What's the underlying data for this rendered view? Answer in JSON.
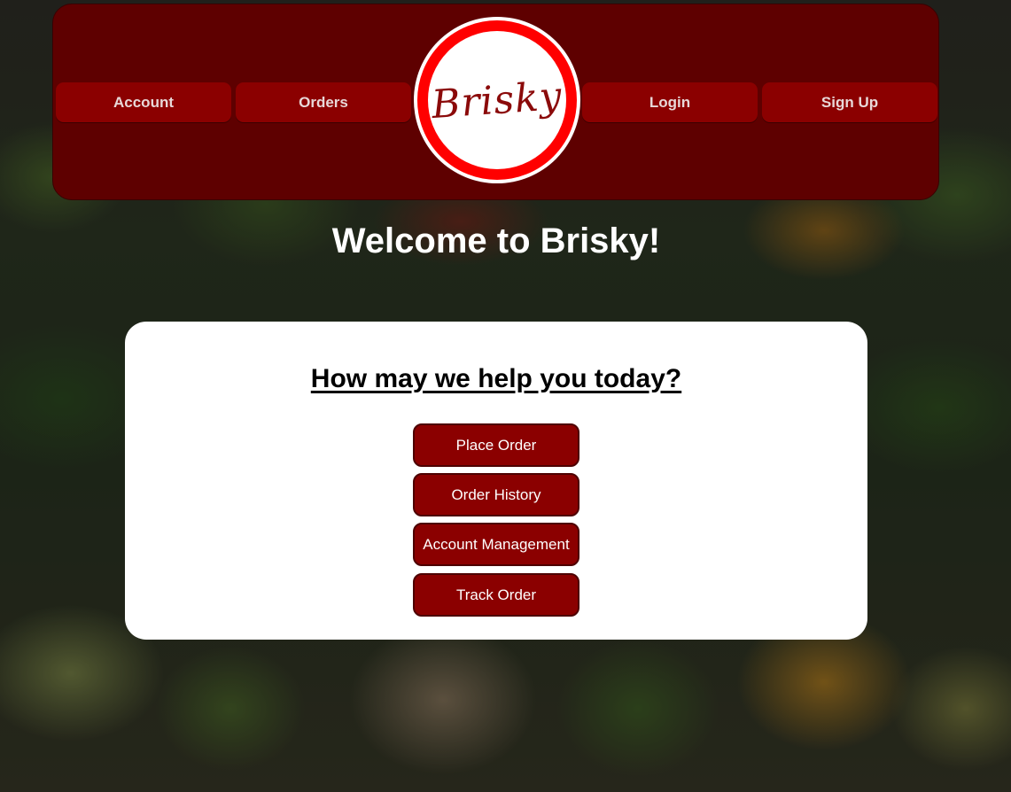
{
  "nav": {
    "account_label": "Account",
    "orders_label": "Orders",
    "login_label": "Login",
    "signup_label": "Sign Up",
    "logo_text": "Brisky"
  },
  "welcome": {
    "title": "Welcome to Brisky!"
  },
  "help_card": {
    "title": "How may we help you today?",
    "buttons": [
      {
        "label": "Place Order"
      },
      {
        "label": "Order History"
      },
      {
        "label": "Account Management"
      },
      {
        "label": "Track Order"
      }
    ]
  },
  "colors": {
    "nav_background": "#5e0000",
    "button_background": "#8b0000",
    "logo_ring": "#ff0000",
    "card_background": "#ffffff"
  },
  "icons": {
    "logo": "brisky-logo-icon"
  }
}
